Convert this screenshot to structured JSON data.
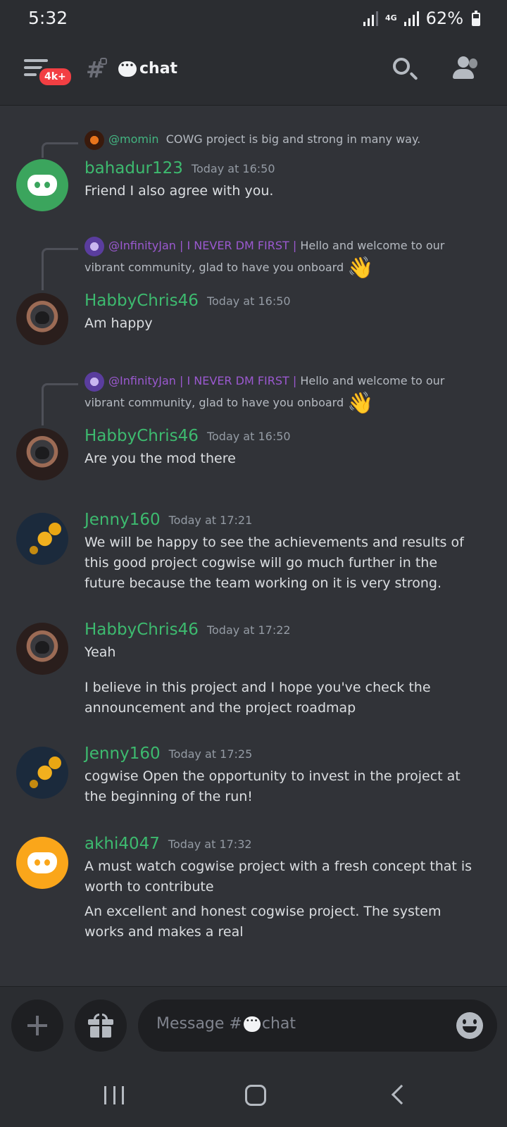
{
  "status": {
    "time": "5:32",
    "network": "4G",
    "battery": "62%"
  },
  "header": {
    "badge": "4k+",
    "channel_name": "chat"
  },
  "messages": [
    {
      "reply": {
        "mention": "@momin",
        "text": "COWG project is big and strong in many way."
      },
      "author": "bahadur123",
      "time": "Today at 16:50",
      "lines": [
        "Friend I also agree with you."
      ]
    },
    {
      "reply": {
        "mention": "@InfinityJan | I NEVER DM FIRST |",
        "text": "Hello and welcome to our vibrant community, glad to have you onboard"
      },
      "author": "HabbyChris46",
      "time": "Today at 16:50",
      "lines": [
        "Am happy"
      ]
    },
    {
      "reply": {
        "mention": "@InfinityJan | I NEVER DM FIRST |",
        "text": "Hello and welcome to our vibrant community, glad to have you onboard"
      },
      "author": "HabbyChris46",
      "time": "Today at 16:50",
      "lines": [
        "Are you the mod there"
      ]
    },
    {
      "author": "Jenny160",
      "time": "Today at 17:21",
      "lines": [
        "We will be happy to see the achievements and results of this good project cogwise will go much further in the future because the team working on it is very strong."
      ]
    },
    {
      "author": "HabbyChris46",
      "time": "Today at 17:22",
      "lines": [
        "Yeah",
        "I believe in this project and I hope you've check the announcement and the project roadmap"
      ]
    },
    {
      "author": "Jenny160",
      "time": "Today at 17:25",
      "lines": [
        "cogwise Open the opportunity to invest in the project at the beginning of the run!"
      ]
    },
    {
      "author": "akhi4047",
      "time": "Today at 17:32",
      "lines": [
        "A must watch cogwise project with a fresh concept that is worth to contribute",
        "An excellent and honest cogwise project. The system works and makes a real"
      ]
    }
  ],
  "input": {
    "placeholder_prefix": "Message #",
    "placeholder_channel": "chat"
  },
  "icons": {
    "wave": "👋",
    "menu": "hamburger-icon",
    "search": "search-icon",
    "members": "members-icon",
    "plus": "plus-icon",
    "gift": "gift-icon",
    "emoji": "emoji-icon"
  },
  "colors": {
    "username": "#3dba6f",
    "mention_purple": "#9b59d0",
    "badge": "#f23f43"
  }
}
